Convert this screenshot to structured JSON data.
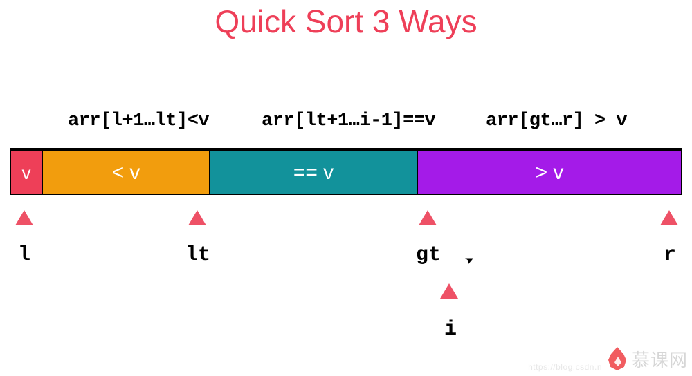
{
  "title": "Quick Sort 3 Ways",
  "formulas": {
    "lt": "arr[l+1…lt]<v",
    "eq": "arr[lt+1…i-1]==v",
    "gt": "arr[gt…r] > v"
  },
  "segments": {
    "pivot": "v",
    "lt": "< v",
    "eq": "== v",
    "gt": "> v"
  },
  "colors": {
    "title": "#ee3f58",
    "pivot": "#ee3f58",
    "lt": "#f29d0d",
    "eq": "#12929b",
    "gt": "#a41be8",
    "pointer": "#ee5166"
  },
  "pointers": {
    "l": "l",
    "lt": "lt",
    "gt": "gt",
    "r": "r",
    "i": "i"
  },
  "watermark": {
    "text": "慕课网",
    "url": "https://blog.csdn.n"
  }
}
